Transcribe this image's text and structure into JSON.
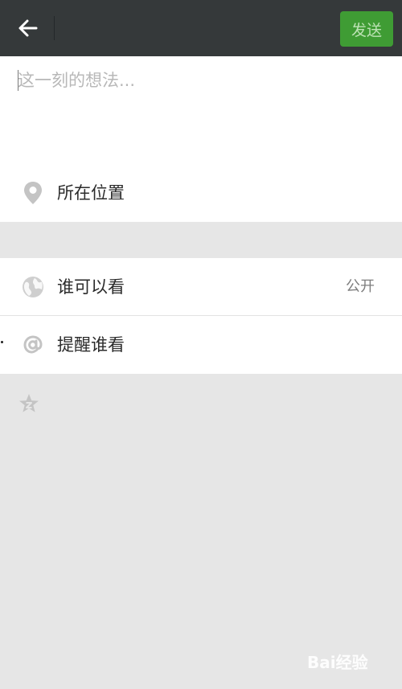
{
  "topbar": {
    "back_icon": "arrow-left-icon",
    "send_label": "发送",
    "send_color": "#3f9c34"
  },
  "compose": {
    "placeholder": "这一刻的想法...",
    "value": ""
  },
  "location": {
    "icon": "location-pin-icon",
    "label": "所在位置"
  },
  "visibility": {
    "icon": "globe-icon",
    "label": "谁可以看",
    "value": "公开"
  },
  "mention": {
    "icon": "at-sign-icon",
    "label": "提醒谁看"
  },
  "extra": {
    "icon": "star-icon"
  },
  "watermark": {
    "text": "Bai经验"
  }
}
